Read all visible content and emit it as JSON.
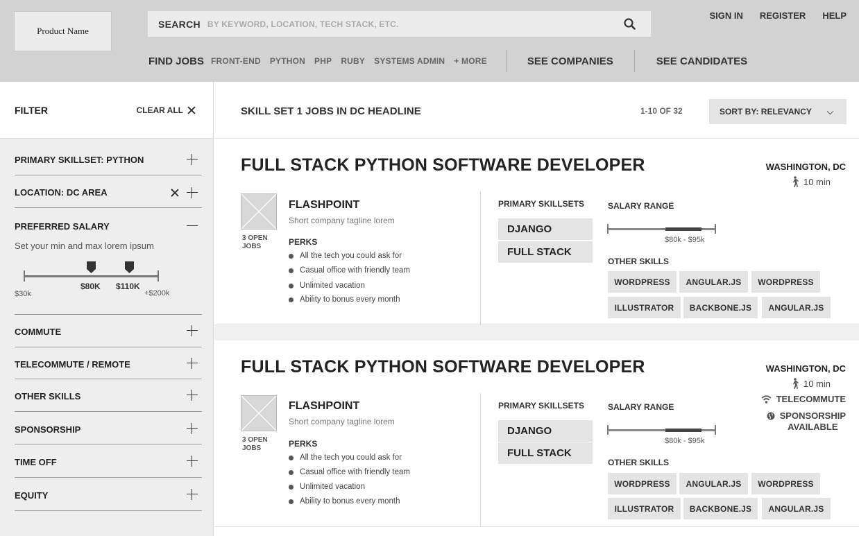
{
  "header": {
    "logo_text": "Product Name",
    "search_label": "SEARCH",
    "search_placeholder": "BY KEYWORD, LOCATION, TECH STACK, ETC.",
    "top_links": [
      "SIGN IN",
      "REGISTER",
      "HELP"
    ],
    "find_jobs": "FIND JOBS",
    "job_tags": [
      "FRONT-END",
      "PYTHON",
      "PHP",
      "RUBY",
      "SYSTEMS ADMIN",
      "+ MORE"
    ],
    "see_companies": "SEE COMPANIES",
    "see_candidates": "SEE CANDIDATES"
  },
  "sidebar": {
    "filter_title": "FILTER",
    "clear_all": "CLEAR ALL",
    "facets": {
      "primary_skillset": "PRIMARY SKILLSET: PYTHON",
      "location": "LOCATION: DC AREA",
      "preferred_salary": "PREFERRED SALARY",
      "commute": "COMMUTE",
      "telecommute": "TELECOMMUTE / REMOTE",
      "other_skills": "OTHER SKILLS",
      "sponsorship": "SPONSORSHIP",
      "time_off": "TIME OFF",
      "equity": "EQUITY"
    },
    "salary": {
      "description": "Set your min and max lorem ipsum",
      "range_min": "$30k",
      "range_max": "+$200k",
      "selected_min": "$80K",
      "selected_max": "$110K"
    }
  },
  "results": {
    "headline": "SKILL SET 1 JOBS IN DC HEADLINE",
    "count": "1-10 OF 32",
    "sort_label": "SORT BY: RELEVANCY"
  },
  "jobs": [
    {
      "title": "FULL STACK PYTHON SOFTWARE DEVELOPER",
      "location": "WASHINGTON, DC",
      "commute": "10 min",
      "company": "FLASHPOINT",
      "tagline": "Short company tagline lorem",
      "open_jobs": "3 OPEN",
      "open_jobs_2": "JOBS",
      "perks_title": "PERKS",
      "perks": [
        "All the tech you could ask for",
        "Casual office with friendly team",
        "Unlimited vacation",
        "Ability to bonus every month"
      ],
      "primary_title": "PRIMARY SKILLSETS",
      "primary": [
        "DJANGO",
        "FULL STACK"
      ],
      "salary_title": "SALARY RANGE",
      "salary_range": "$80k - $95k",
      "other_title": "OTHER SKILLS",
      "other_skills": [
        "WORDPRESS",
        "ANGULAR.JS",
        "WORDPRESS",
        "ILLUSTRATOR",
        "BACKBONE.JS",
        "ANGULAR.JS"
      ]
    },
    {
      "title": "FULL STACK PYTHON SOFTWARE DEVELOPER",
      "location": "WASHINGTON, DC",
      "commute": "10 min",
      "telecommute": "TELECOMMUTE",
      "sponsorship_1": "SPONSORSHIP",
      "sponsorship_2": "AVAILABLE",
      "company": "FLASHPOINT",
      "tagline": "Short company tagline lorem",
      "open_jobs": "3 OPEN",
      "open_jobs_2": "JOBS",
      "perks_title": "PERKS",
      "perks": [
        "All the tech you could ask for",
        "Casual office with friendly team",
        "Unlimited vacation",
        "Ability to bonus every month"
      ],
      "primary_title": "PRIMARY SKILLSETS",
      "primary": [
        "DJANGO",
        "FULL STACK"
      ],
      "salary_title": "SALARY RANGE",
      "salary_range": "$80k - $95k",
      "other_title": "OTHER SKILLS",
      "other_skills": [
        "WORDPRESS",
        "ANGULAR.JS",
        "WORDPRESS",
        "ILLUSTRATOR",
        "BACKBONE.JS",
        "ANGULAR.JS"
      ]
    }
  ]
}
